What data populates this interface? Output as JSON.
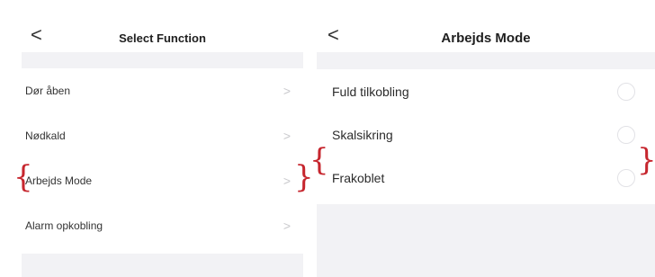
{
  "select_function": {
    "back_glyph": "<",
    "title": "Select Function",
    "items": [
      {
        "label": "Dør åben",
        "chevron": ">"
      },
      {
        "label": "Nødkald",
        "chevron": ">"
      },
      {
        "label": "Arbejds Mode",
        "chevron": ">"
      },
      {
        "label": "Alarm opkobling",
        "chevron": ">"
      }
    ]
  },
  "arbejds_mode": {
    "back_glyph": "<",
    "title": "Arbejds Mode",
    "options": [
      {
        "label": "Fuld tilkobling",
        "selected": false
      },
      {
        "label": "Skalsikring",
        "selected": false
      },
      {
        "label": "Frakoblet",
        "selected": false
      }
    ]
  },
  "annotations": {
    "brace_left": "{",
    "brace_right": "}",
    "color": "#c6262e"
  }
}
